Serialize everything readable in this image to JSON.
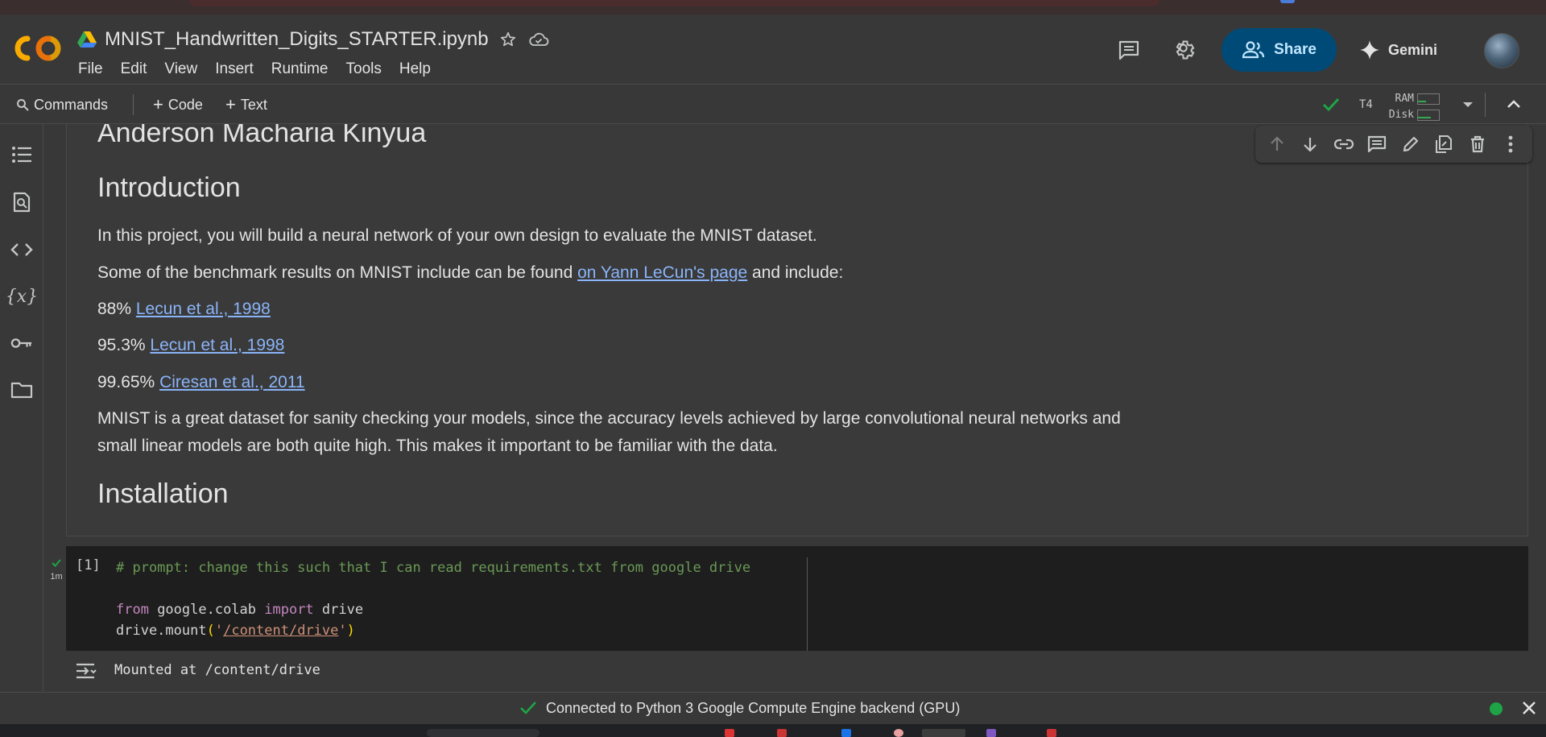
{
  "notebook": {
    "title": "MNIST_Handwritten_Digits_STARTER.ipynb",
    "menu": [
      "File",
      "Edit",
      "View",
      "Insert",
      "Runtime",
      "Tools",
      "Help"
    ]
  },
  "header": {
    "share_label": "Share",
    "gemini_label": "Gemini"
  },
  "toolbar": {
    "commands_label": "Commands",
    "code_label": "Code",
    "text_label": "Text",
    "runtime_type": "T4",
    "ram_label": "RAM",
    "disk_label": "Disk"
  },
  "text_cell": {
    "author": "Anderson Macharia Kinyua",
    "intro_heading": "Introduction",
    "intro_p1": "In this project, you will build a neural network of your own design to evaluate the MNIST dataset.",
    "intro_p2_before": "Some of the benchmark results on MNIST include can be found ",
    "intro_p2_link": "on Yann LeCun's page",
    "intro_p2_after": " and include:",
    "results": [
      {
        "score": "88% ",
        "link": "Lecun et al., 1998"
      },
      {
        "score": "95.3% ",
        "link": "Lecun et al., 1998"
      },
      {
        "score": "99.65% ",
        "link": "Ciresan et al., 2011"
      }
    ],
    "intro_p3_line1": "MNIST is a great dataset for sanity checking your models, since the accuracy levels achieved by large convolutional neural networks and",
    "intro_p3_line2": "small linear models are both quite high. This makes it important to be familiar with the data.",
    "install_heading": "Installation"
  },
  "code_cell": {
    "exec_count": "[1]",
    "run_time": "1m",
    "comment": "# prompt: change this such that I can read requirements.txt from google drive",
    "line2_kw1": "from",
    "line2_mod": " google.colab ",
    "line2_kw2": "import",
    "line2_name": " drive",
    "line3_call": "drive.mount",
    "line3_open": "(",
    "line3_q1": "'",
    "line3_path": "/content/drive",
    "line3_q2": "'",
    "line3_close": ")",
    "output": "Mounted at /content/drive"
  },
  "status_bar": {
    "message": "Connected to Python 3 Google Compute Engine backend (GPU)"
  },
  "colors": {
    "share_bg": "#004a77",
    "link": "#8ab4f8",
    "ok_green": "#1ea446"
  }
}
